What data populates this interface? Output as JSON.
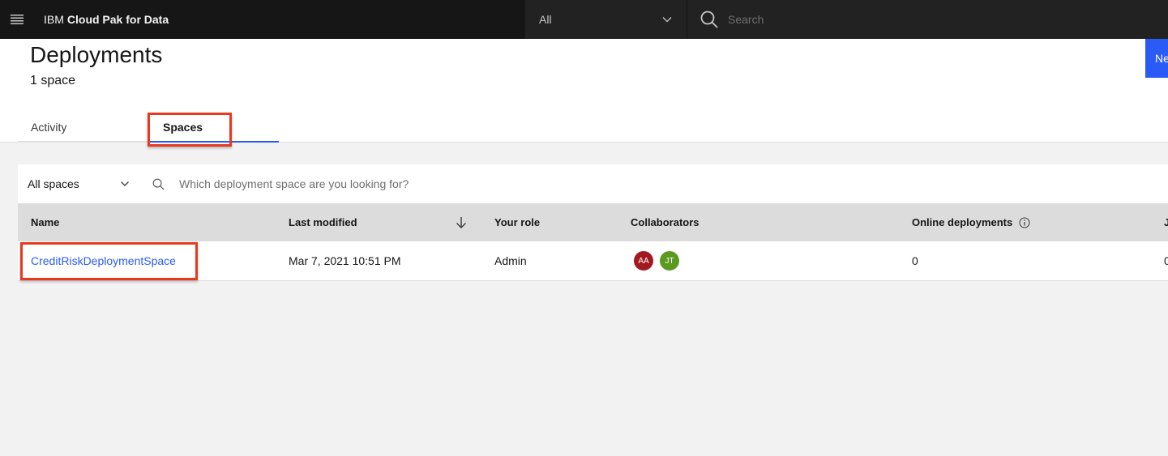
{
  "header": {
    "brand_prefix": "IBM",
    "brand_product": "Cloud Pak for Data",
    "scope_selected": "All",
    "search_placeholder": "Search"
  },
  "page": {
    "title": "Deployments",
    "subtitle": "1 space",
    "new_button_label": "Ne",
    "tabs": [
      {
        "label": "Activity",
        "active": false
      },
      {
        "label": "Spaces",
        "active": true
      }
    ]
  },
  "toolbar": {
    "filter_selected": "All spaces",
    "search_placeholder": "Which deployment space are you looking for?"
  },
  "table": {
    "columns": [
      "Name",
      "Last modified",
      "Your role",
      "Collaborators",
      "Online deployments",
      "J"
    ],
    "sort_column": "Last modified",
    "sort_direction": "descending",
    "rows": [
      {
        "name": "CreditRiskDeploymentSpace",
        "last_modified": "Mar 7, 2021 10:51 PM",
        "role": "Admin",
        "collaborators": [
          {
            "initials": "AA",
            "color": "#a2191f"
          },
          {
            "initials": "JT",
            "color": "#5a9a1f"
          }
        ],
        "online_deployments": "0",
        "next_col": "0"
      }
    ]
  },
  "colors": {
    "accent": "#2a5bf6",
    "highlight": "#e8391f",
    "header_bg": "#161616"
  }
}
